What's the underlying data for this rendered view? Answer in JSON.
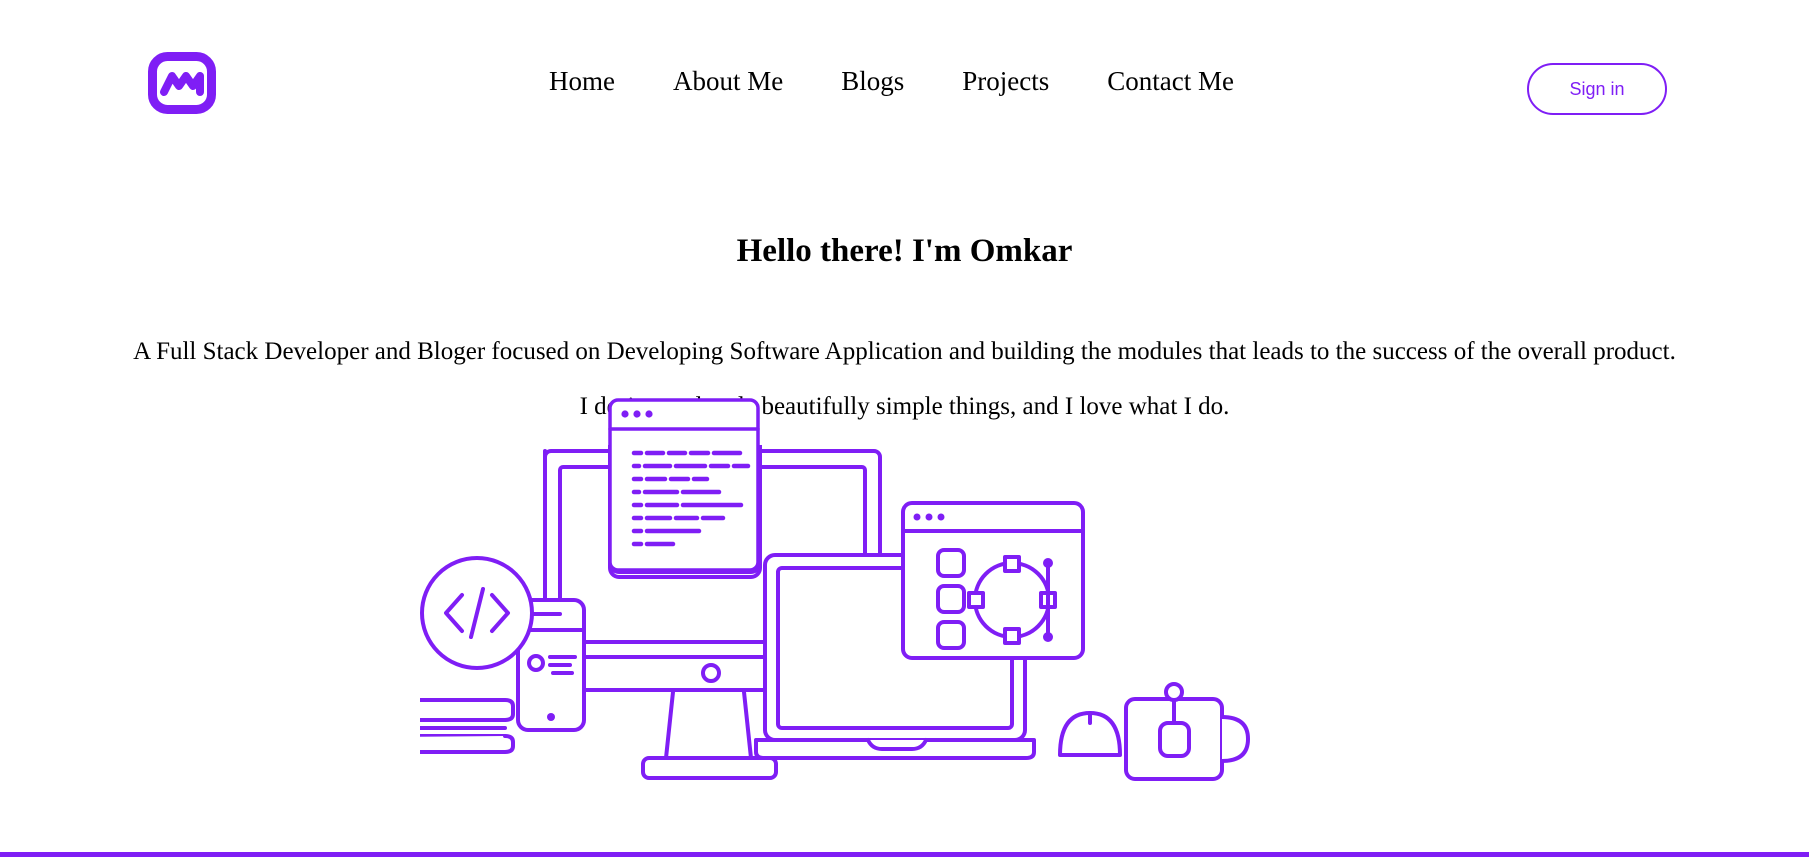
{
  "theme": {
    "accent": "#7f1ef5",
    "background": "#ffffff",
    "text": "#000000"
  },
  "header": {
    "brand": {
      "icon": "rounded-square-wave-logo",
      "color": "#7f1ef5"
    },
    "nav_items": [
      {
        "label": "Home"
      },
      {
        "label": "About Me"
      },
      {
        "label": "Blogs"
      },
      {
        "label": "Projects"
      },
      {
        "label": "Contact Me"
      }
    ],
    "signin_label": "Sign in"
  },
  "hero": {
    "title": "Hello there! I'm Omkar",
    "paragraph_line1": "A Full Stack Developer and Bloger focused on Developing Software Application and building the modules that leads to the success of the overall product.",
    "paragraph_line2": "I design and code beautifully simple things, and I love what I do.",
    "illustration": {
      "name": "developer-workspace-illustration",
      "stroke_color": "#7f1ef5",
      "elements": [
        "code-editor-window",
        "design-tool-window",
        "desktop-monitor",
        "laptop",
        "smartphone",
        "code-badge-circle",
        "stacked-books",
        "computer-mouse",
        "coffee-mug"
      ]
    }
  },
  "footer": {
    "divider": "ground-line"
  }
}
